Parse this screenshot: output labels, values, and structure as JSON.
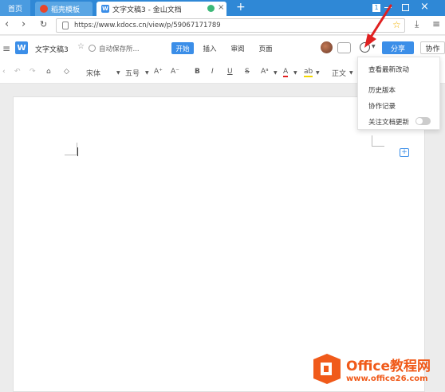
{
  "tabs": {
    "home": "首页",
    "template": "稻壳模板",
    "doc": "文字文稿3 - 金山文档",
    "new_tab": "+"
  },
  "address": {
    "url": "https://www.kdocs.cn/view/p/59067171789"
  },
  "doc_header": {
    "logo_letter": "W",
    "title": "文字文稿3",
    "save_status": "自动保存所...",
    "menu_tabs": [
      "开始",
      "插入",
      "审阅",
      "页面"
    ],
    "share_button": "分享",
    "collab_button": "协作"
  },
  "toolbar": {
    "font_name": "宋体",
    "font_size": "五号",
    "grow": "A⁺",
    "shrink": "A⁻",
    "bold": "B",
    "italic": "I",
    "underline": "U",
    "strike": "S",
    "aa": "Aᵃ",
    "font_color": "A",
    "highlight": "ab",
    "style": "正文"
  },
  "history_menu": {
    "items": [
      "查看最新改动",
      "历史版本",
      "协作记录",
      "关注文档更新"
    ]
  },
  "watermark": {
    "title": "Office教程网",
    "url": "www.office26.com"
  },
  "colors": {
    "tabbar": "#2f88d6",
    "accent": "#3b8ee8",
    "share": "#3b8ee8",
    "watermark_orange": "#f05a1a",
    "arrow_red": "#e02020"
  }
}
